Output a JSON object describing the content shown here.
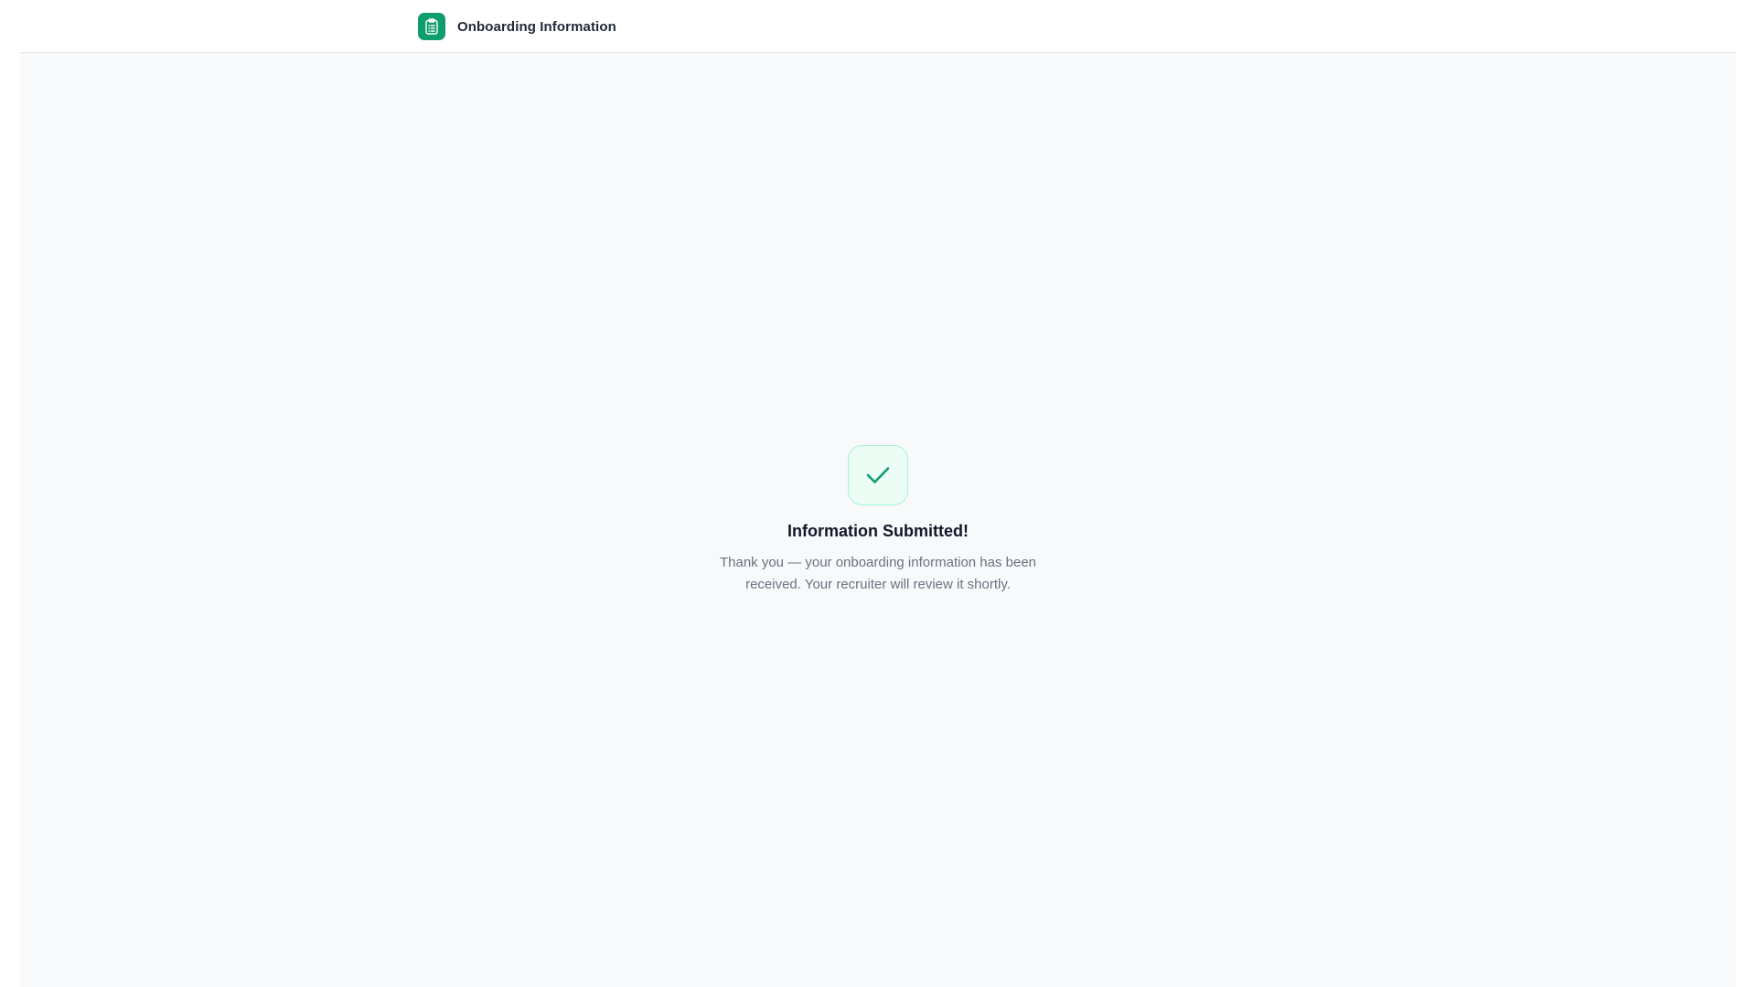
{
  "header": {
    "title": "Onboarding Information",
    "icon": "clipboard-icon",
    "accent": "#0f9d6c"
  },
  "confirmation": {
    "icon": "check-icon",
    "title": "Information Submitted!",
    "message": "Thank you — your onboarding information has been received. Your recruiter will review it shortly."
  },
  "colors": {
    "background": "#f8f9fb",
    "success_bg": "#ecfdf5",
    "success_border": "#a7f3d0",
    "success_check": "#0f9d6c"
  }
}
